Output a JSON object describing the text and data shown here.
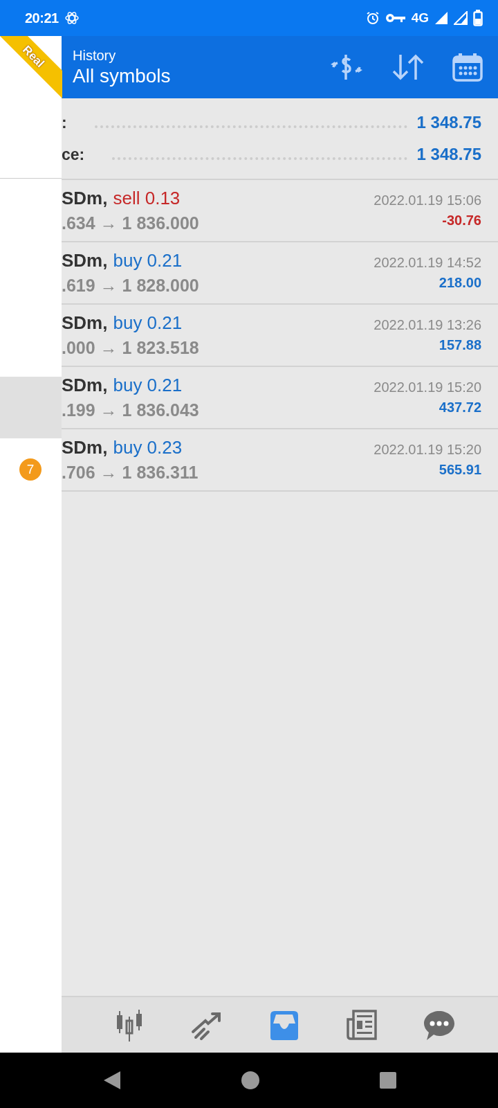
{
  "status_bar": {
    "time": "20:21",
    "network": "4G"
  },
  "header": {
    "badge": "Real",
    "subtitle": "History",
    "title": "All symbols"
  },
  "drawer": {
    "items": [
      {
        "selected": false
      },
      {
        "selected": false
      },
      {
        "selected": false
      },
      {
        "selected": true
      },
      {
        "selected": false,
        "badge": "7"
      }
    ]
  },
  "summary": [
    {
      "label": ":",
      "value": "1 348.75"
    },
    {
      "label": "ce:",
      "value": "1 348.75"
    }
  ],
  "deals": [
    {
      "symbol": "SDm,",
      "side": "sell",
      "volume": "0.13",
      "prices": ".634 → 1 836.000",
      "time": "2022.01.19 15:06",
      "profit": "-30.76",
      "color": "#c62828"
    },
    {
      "symbol": "SDm,",
      "side": "buy",
      "volume": "0.21",
      "prices": ".619 → 1 828.000",
      "time": "2022.01.19 14:52",
      "profit": "218.00",
      "color": "#1a6fc9"
    },
    {
      "symbol": "SDm,",
      "side": "buy",
      "volume": "0.21",
      "prices": ".000 → 1 823.518",
      "time": "2022.01.19 13:26",
      "profit": "157.88",
      "color": "#1a6fc9"
    },
    {
      "symbol": "SDm,",
      "side": "buy",
      "volume": "0.21",
      "prices": ".199 → 1 836.043",
      "time": "2022.01.19 15:20",
      "profit": "437.72",
      "color": "#1a6fc9"
    },
    {
      "symbol": "SDm,",
      "side": "buy",
      "volume": "0.23",
      "prices": ".706 → 1 836.311",
      "time": "2022.01.19 15:20",
      "profit": "565.91",
      "color": "#1a6fc9"
    }
  ],
  "bottom_nav": [
    {
      "kind": "candles",
      "selected": false
    },
    {
      "kind": "trend",
      "selected": false
    },
    {
      "kind": "history",
      "selected": true
    },
    {
      "kind": "news",
      "selected": false
    },
    {
      "kind": "chat",
      "selected": false
    }
  ]
}
